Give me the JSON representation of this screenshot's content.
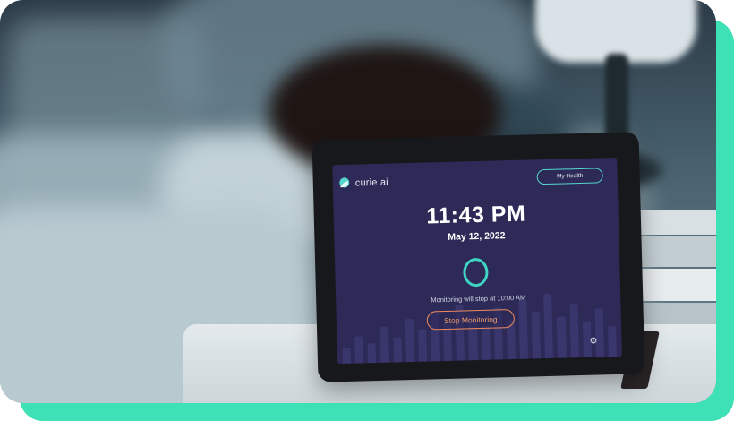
{
  "app": {
    "brand_name": "curie ai",
    "header_button_label": "My Health",
    "time": "11:43 PM",
    "date": "May 12, 2022",
    "monitoring_message": "Monitoring will stop at 10:00 AM",
    "stop_button_label": "Stop Monitoring",
    "settings_icon": "gear-icon",
    "status_indicator_icon": "ring-icon"
  },
  "colors": {
    "accent_frame": "#3ee0b5",
    "screen_background": "#2d2a57",
    "teal_ring": "#3fd4c4",
    "stop_button": "#ee8b5d"
  }
}
